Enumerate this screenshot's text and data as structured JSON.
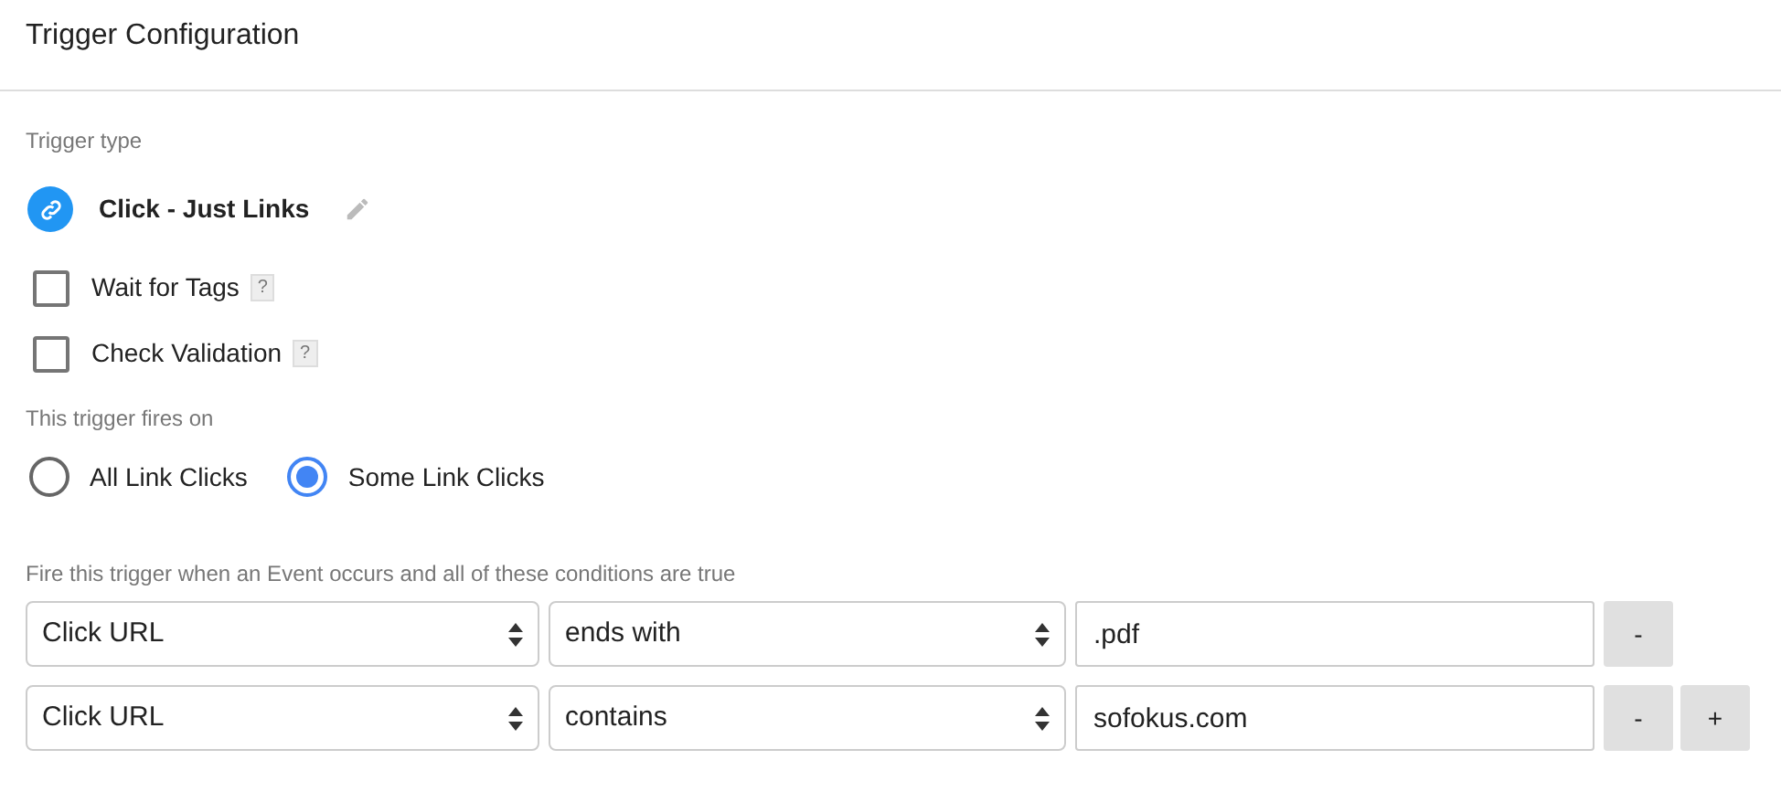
{
  "header": {
    "title": "Trigger Configuration"
  },
  "trigger_type": {
    "label": "Trigger type",
    "name": "Click - Just Links"
  },
  "options": [
    {
      "label": "Wait for Tags",
      "help": "?",
      "checked": false
    },
    {
      "label": "Check Validation",
      "help": "?",
      "checked": false
    }
  ],
  "fires_on": {
    "label": "This trigger fires on",
    "choices": [
      {
        "label": "All Link Clicks",
        "selected": false
      },
      {
        "label": "Some Link Clicks",
        "selected": true
      }
    ]
  },
  "conditions": {
    "label": "Fire this trigger when an Event occurs and all of these conditions are true",
    "rows": [
      {
        "variable": "Click URL",
        "operator": "ends with",
        "value": ".pdf",
        "buttons": [
          "-"
        ]
      },
      {
        "variable": "Click URL",
        "operator": "contains",
        "value": "sofokus.com",
        "buttons": [
          "-",
          "+"
        ]
      }
    ]
  }
}
